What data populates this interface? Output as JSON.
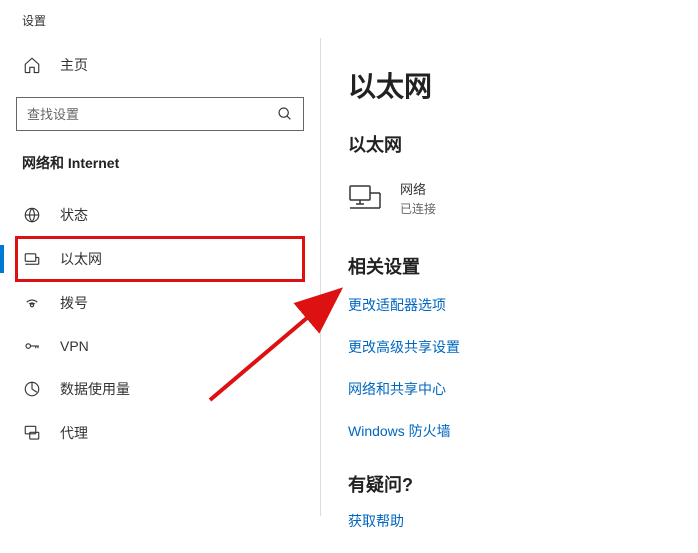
{
  "header": {
    "title": "设置"
  },
  "sidebar": {
    "home": "主页",
    "search_placeholder": "查找设置",
    "section": "网络和 Internet",
    "items": [
      {
        "label": "状态"
      },
      {
        "label": "以太网"
      },
      {
        "label": "拨号"
      },
      {
        "label": "VPN"
      },
      {
        "label": "数据使用量"
      },
      {
        "label": "代理"
      }
    ]
  },
  "main": {
    "title": "以太网",
    "subheading": "以太网",
    "network": {
      "name": "网络",
      "status": "已连接"
    },
    "related_title": "相关设置",
    "links": [
      "更改适配器选项",
      "更改高级共享设置",
      "网络和共享中心",
      "Windows 防火墙"
    ],
    "question_title": "有疑问?",
    "help_link": "获取帮助"
  }
}
